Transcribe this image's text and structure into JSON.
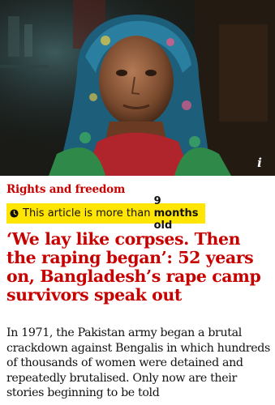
{
  "hero": {
    "image_icon": "portrait-photo",
    "info_icon": "info-icon",
    "info_label": "i"
  },
  "article": {
    "kicker": "Rights and freedom",
    "age_warning": {
      "icon": "clock-icon",
      "prefix": "This article is more than ",
      "age": "9 months old",
      "background_color": "#ffe500"
    },
    "headline": "‘We lay like corpses. Then the raping began’: 52 years on, Bangladesh’s rape camp survivors speak out",
    "standfirst": "In 1971, the Pakistan army began a brutal crackdown against Bengalis in which hundreds of thousands of women were detained and repeatedly brutalised. Only now are their stories beginning to be told"
  },
  "colors": {
    "accent": "#c70000",
    "text": "#121212",
    "banner": "#ffe500"
  }
}
